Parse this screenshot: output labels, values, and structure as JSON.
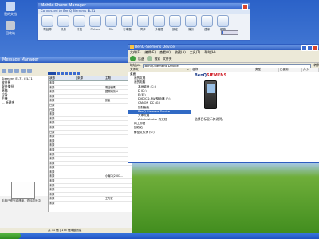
{
  "desktop_icons": [
    {
      "label": "我的文档",
      "color": "#c9d9f4"
    },
    {
      "label": "回收站",
      "color": "#c3c9d4"
    }
  ],
  "phone_manager": {
    "title": "Mobile Phone Manager",
    "subtitle": "Connected to BenQ Siemens EL71",
    "tools": [
      {
        "icon": "phone-icon",
        "label": "電話簿"
      },
      {
        "icon": "message-icon",
        "label": "訊息"
      },
      {
        "icon": "sound-icon",
        "label": "鈴聲"
      },
      {
        "icon": "image-icon",
        "label": "Picture"
      },
      {
        "icon": "file-icon",
        "label": "File"
      },
      {
        "icon": "calendar-icon",
        "label": "行事曆"
      },
      {
        "icon": "sync-icon",
        "label": "同步"
      },
      {
        "icon": "music-icon",
        "label": "多媒體"
      },
      {
        "icon": "settings-icon",
        "label": "設定"
      },
      {
        "icon": "backup-icon",
        "label": "備份"
      },
      {
        "icon": "web-icon",
        "label": "連線"
      },
      {
        "icon": "globe-icon",
        "label": "網路"
      }
    ]
  },
  "left_window": {
    "title": "Message Manager",
    "tree": [
      "Siemens EL71 (EL71)",
      "收件匣",
      "寄件備份",
      "草稿",
      "垃圾",
      "手機",
      "... 新建夾"
    ],
    "grid_headers": [
      "狀態",
      "來源",
      "主題"
    ],
    "rows": [
      [
        "未讀",
        "",
        ""
      ],
      [
        "未讀",
        "",
        "電話號碼"
      ],
      [
        "未讀",
        "",
        "國際短訊(A..."
      ],
      [
        "未讀",
        "",
        ""
      ],
      [
        "未讀",
        "",
        "訊息"
      ],
      [
        "已讀",
        "",
        ""
      ],
      [
        "已讀",
        "",
        ""
      ],
      [
        "未讀",
        "",
        ""
      ],
      [
        "未讀",
        "",
        ""
      ],
      [
        "未讀",
        "",
        ""
      ],
      [
        "未讀",
        "",
        ""
      ],
      [
        "已讀",
        "",
        ""
      ],
      [
        "未讀",
        "",
        ""
      ],
      [
        "未讀",
        "",
        ""
      ],
      [
        "未讀",
        "",
        ""
      ],
      [
        "未讀",
        "",
        ""
      ],
      [
        "未讀",
        "",
        ""
      ],
      [
        "未讀",
        "",
        ""
      ],
      [
        "未讀",
        "",
        ""
      ],
      [
        "未讀",
        "",
        ""
      ],
      [
        "未讀",
        "",
        ""
      ],
      [
        "未讀",
        "",
        "小兩口(2007..."
      ],
      [
        "未讀",
        "",
        ""
      ],
      [
        "未讀",
        "",
        ""
      ],
      [
        "未讀",
        "",
        ""
      ],
      [
        "未讀",
        "",
        ""
      ],
      [
        "未讀",
        "",
        "王力宏"
      ],
      [
        "未讀",
        "",
        ""
      ]
    ],
    "hint": "手機已經完成連線，資料同步中",
    "status": "共 31 個 | 175 個未讀訊息"
  },
  "explorer": {
    "title": "BenQ-Siemens Device",
    "menu": [
      "文件(F)",
      "编辑(E)",
      "查看(V)",
      "收藏(A)",
      "工具(T)",
      "帮助(H)"
    ],
    "toolbar": {
      "back": "后退",
      "search": "搜索",
      "folders": "文件夹"
    },
    "address_label": "地址(D)",
    "address": "BenQ-Siemens Device",
    "go": "转到",
    "folders_header": "文件夹",
    "tree": [
      {
        "label": "桌面",
        "indent": 0
      },
      {
        "label": "我的文档",
        "indent": 1
      },
      {
        "label": "我的电脑",
        "indent": 1
      },
      {
        "label": "本地磁盘 (C:)",
        "indent": 2
      },
      {
        "label": "D (D:)",
        "indent": 2
      },
      {
        "label": "E (E:)",
        "indent": 2
      },
      {
        "label": "DVD/CD-RW 驱动器 (F:)",
        "indent": 2
      },
      {
        "label": "CANON_DC (G:)",
        "indent": 2
      },
      {
        "label": "控制面板",
        "indent": 2
      },
      {
        "label": "BenQ-Siemens Device",
        "indent": 2,
        "selected": true
      },
      {
        "label": "共享文档",
        "indent": 2
      },
      {
        "label": "Administrator 的文档",
        "indent": 2
      },
      {
        "label": "网上邻居",
        "indent": 1
      },
      {
        "label": "回收站",
        "indent": 1
      },
      {
        "label": "解密文件夹 (C:)",
        "indent": 1
      }
    ],
    "columns": [
      "名称",
      "类型",
      "已使用",
      "大小"
    ],
    "brand_main": "BenQ",
    "brand_accent": "SIEMENS",
    "description": "选择目标显示其说明。"
  }
}
